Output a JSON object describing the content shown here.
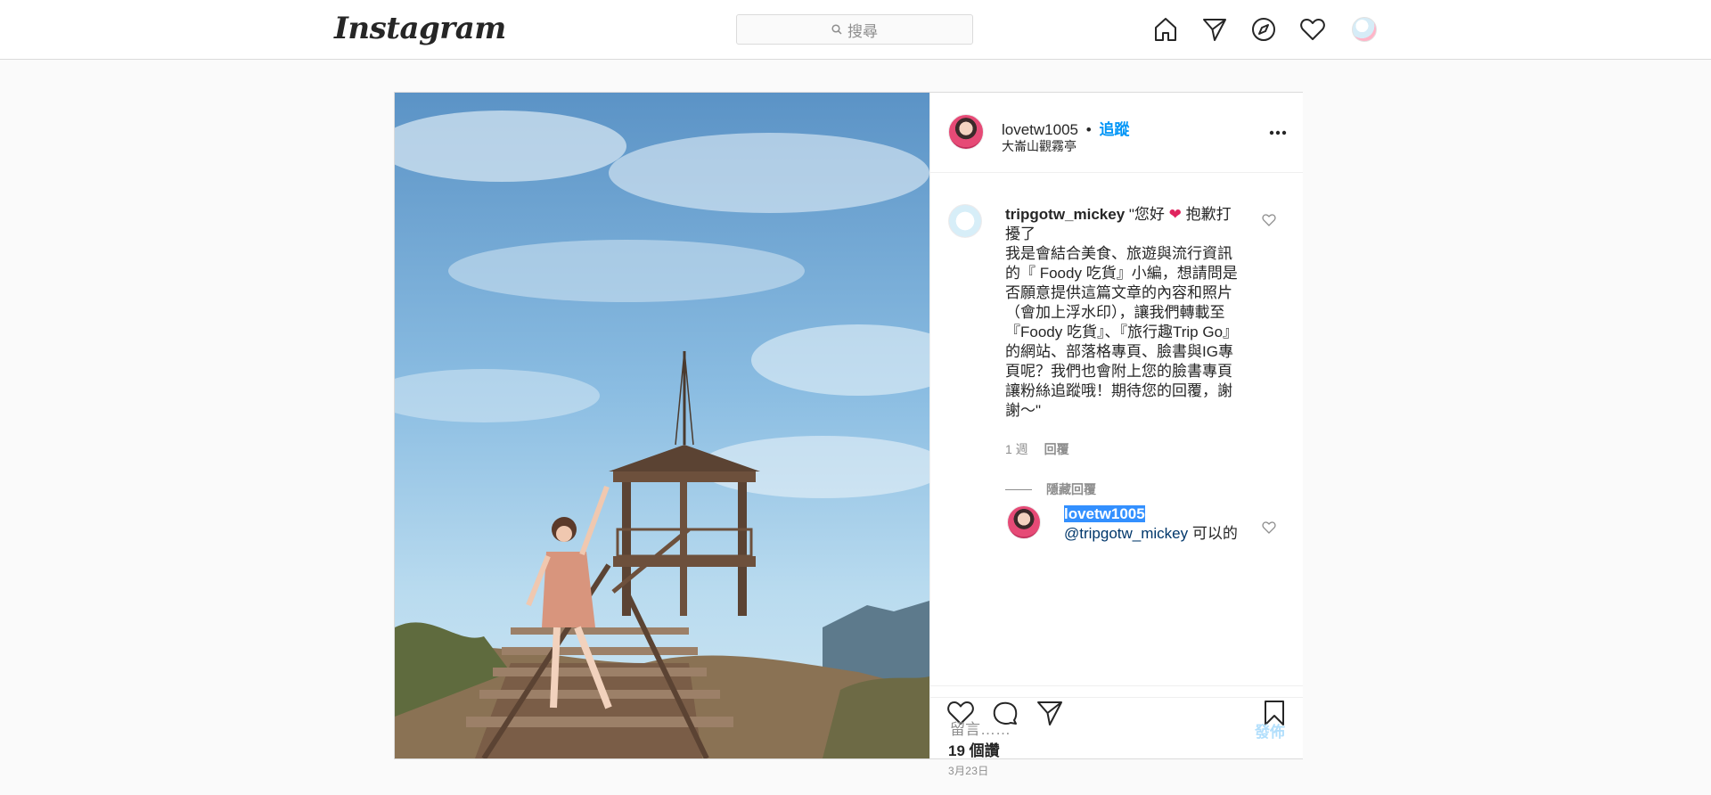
{
  "nav": {
    "logo": "Instagram",
    "search_placeholder": "搜尋",
    "icons": [
      "home-icon",
      "direct-icon",
      "explore-icon",
      "activity-heart-icon",
      "profile-avatar"
    ]
  },
  "post": {
    "author": "lovetw1005",
    "separator": "•",
    "follow_label": "追蹤",
    "location": "大崙山觀霧亭",
    "comments": [
      {
        "user": "tripgotw_mickey",
        "text_before_emoji": "\"您好",
        "emoji": "❤",
        "text_after_emoji": " 抱歉打擾了\n我是會結合美食、旅遊與流行資訊的『 Foody 吃貨』小編，想請問是否願意提供這篇文章的內容和照片（會加上浮水印），讓我們轉載至『Foody 吃貨』、『旅行趣Trip Go』的網站、部落格專頁、臉書與IG專頁呢？我們也會附上您的臉書專頁讓粉絲追蹤哦！期待您的回覆，謝謝～\"",
        "time": "1 週",
        "reply_label": "回覆",
        "hide_replies_label": "隱藏回覆",
        "reply": {
          "user": "lovetw1005",
          "mention": "@tripgotw_mickey",
          "text": " 可以的"
        }
      }
    ],
    "likes": "19 個讚",
    "date": "3月23日",
    "comment_placeholder": "留言……",
    "post_label": "發佈"
  },
  "colors": {
    "link_blue": "#0095f6",
    "post_disabled": "#b2dffc",
    "selection": "#3390ff"
  }
}
